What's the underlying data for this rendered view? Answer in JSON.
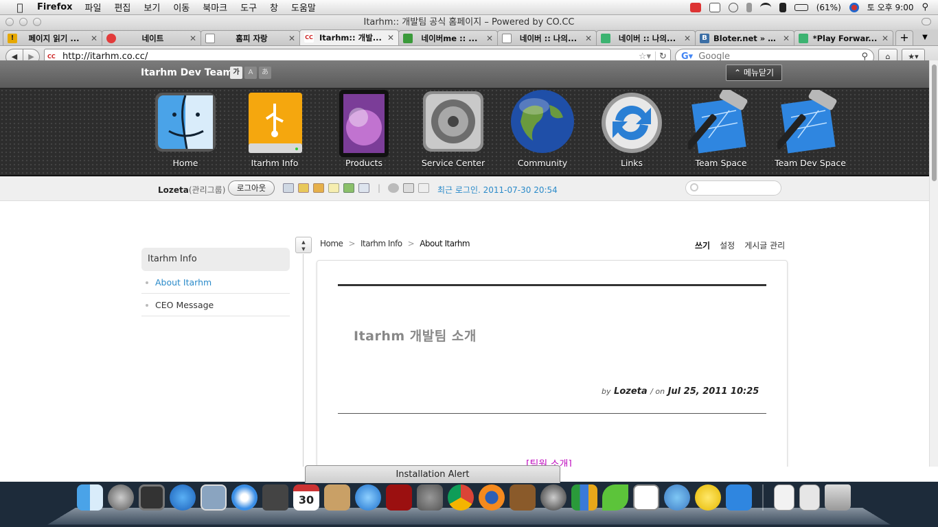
{
  "menubar": {
    "app_name": "Firefox",
    "items": [
      "파일",
      "편집",
      "보기",
      "이동",
      "북마크",
      "도구",
      "창",
      "도움말"
    ],
    "battery": "(61%)",
    "clock": "토 오후 9:00"
  },
  "window": {
    "title": "Itarhm:: 개발팀 공식 홈페이지 – Powered by CO.CC"
  },
  "tabs": [
    {
      "label": "페이지 읽기 ...",
      "icon_color": "#e6a800"
    },
    {
      "label": "네이트",
      "icon_color": "#e23b3b"
    },
    {
      "label": "홈피 자랑",
      "icon_color": "#ffffff"
    },
    {
      "label": "Itarhm:: 개발...",
      "icon_color": "#c22222"
    },
    {
      "label": "네이버me :: ...",
      "icon_color": "#3a9a3a"
    },
    {
      "label": "네이버 :: 나의...",
      "icon_color": "#ffffff"
    },
    {
      "label": "네이버 :: 나의...",
      "icon_color": "#3cb371"
    },
    {
      "label": "Bloter.net » B...",
      "icon_color": "#3b6ea5"
    },
    {
      "label": "*Play Forwar...",
      "icon_color": "#3cb371"
    }
  ],
  "navbar": {
    "url": "http://itarhm.co.cc/",
    "search_placeholder": "Google"
  },
  "site": {
    "team_name": "Itarhm Dev Team",
    "font_buttons": [
      "가",
      "A",
      "あ"
    ],
    "menu_close": "메뉴닫기",
    "nav_items": [
      {
        "label": "Home",
        "icon": "finder-icon"
      },
      {
        "label": "Itarhm Info",
        "icon": "usb-drive-icon"
      },
      {
        "label": "Products",
        "icon": "ipad-icon"
      },
      {
        "label": "Service Center",
        "icon": "gear-settings-icon"
      },
      {
        "label": "Community",
        "icon": "globe-icon"
      },
      {
        "label": "Links",
        "icon": "sync-arrows-icon"
      },
      {
        "label": "Team Space",
        "icon": "xcode-hammer-icon"
      },
      {
        "label": "Team Dev Space",
        "icon": "xcode-hammer-icon"
      }
    ],
    "user": {
      "name": "Lozeta",
      "group": "(관리그룹)",
      "logout": "로그아웃",
      "last_login": "최근 로그인. 2011-07-30 20:54"
    },
    "sidebar": {
      "heading": "Itarhm Info",
      "items": [
        "About Itarhm",
        "CEO Message"
      ]
    },
    "breadcrumb": {
      "home": "Home",
      "section": "Itarhm Info",
      "current": "About Itarhm"
    },
    "post_actions": {
      "write": "쓰기",
      "settings": "설정",
      "manage": "게시글 관리"
    },
    "post": {
      "title": "Itarhm 개발팀 소개",
      "by_label": "by",
      "author": "Lozeta",
      "on_label": "/   on",
      "date": "Jul 25, 2011 10:25",
      "intro": "[팀원 소개]"
    }
  },
  "alert": {
    "label": "Installation Alert"
  },
  "dock": {
    "icons": [
      "finder-icon",
      "launchpad-icon",
      "photo-booth-icon",
      "app-store-icon",
      "preview-icon",
      "safari-icon",
      "facetime-icon",
      "calendar-icon",
      "address-book-icon",
      "itunes-icon",
      "dvd-player-icon",
      "system-preferences-icon",
      "chrome-icon",
      "firefox-icon",
      "keynote-icon",
      "xcode-pen-icon",
      "numbers-icon",
      "leaf-icon",
      "nate-icon",
      "messenger-icon",
      "adium-icon",
      "xcode-icon"
    ],
    "calendar_day": "30",
    "right_icons": [
      "rtf-document-icon",
      "document-icon",
      "trash-icon"
    ]
  }
}
